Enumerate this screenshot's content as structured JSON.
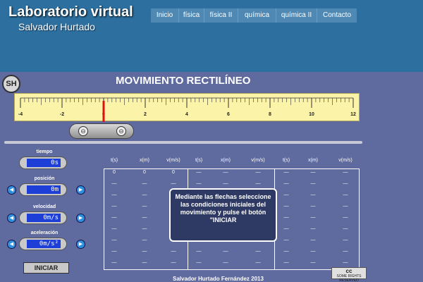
{
  "header": {
    "title": "Laboratorio virtual",
    "subtitle": "Salvador Hurtado",
    "nav": [
      "Inicio",
      "física",
      "física II",
      "química",
      "química II",
      "Contacto"
    ]
  },
  "sim": {
    "logo": "SH",
    "title": "MOVIMIENTO RECTILÍNEO",
    "ruler": {
      "min": -4,
      "max": 12,
      "labels": [
        "-4",
        "-2",
        "0",
        "2",
        "4",
        "6",
        "8",
        "10",
        "12"
      ],
      "marker_value": 0
    },
    "cart_wheel_symbol": "⊖",
    "controls": {
      "tiempo": {
        "label": "tiempo",
        "value": "0s"
      },
      "posicion": {
        "label": "posición",
        "value": "0m"
      },
      "velocidad": {
        "label": "velocidad",
        "value": "0m/s"
      },
      "aceleracion": {
        "label": "aceleración",
        "value": "0m/s²"
      }
    },
    "arrow_left": "◀",
    "arrow_right": "▶",
    "start_label": "INICIAR",
    "table": {
      "headers": [
        "t(s)",
        "x(m)",
        "v(m/s)",
        "t(s)",
        "x(m)",
        "v(m/s)",
        "t(s)",
        "x(m)",
        "v(m/s)"
      ],
      "first_row": [
        "0",
        "0",
        "0"
      ],
      "placeholder": "—"
    },
    "message": "Mediante las flechas seleccione las condiciones iniciales del movimiento y pulse el botón \"INICIAR",
    "footer": "Salvador Hurtado Fernández 2013",
    "cc_badge": {
      "symbol": "cc",
      "text": "SOME RIGHTS RESERVED"
    }
  },
  "colors": {
    "header_bg": "#2d6f9e",
    "sim_bg": "#5f6a9e",
    "ruler_bg": "#fbf3a8",
    "marker": "#e01010",
    "display": "#1d3fd8",
    "arrow": "#2f8fe0"
  }
}
